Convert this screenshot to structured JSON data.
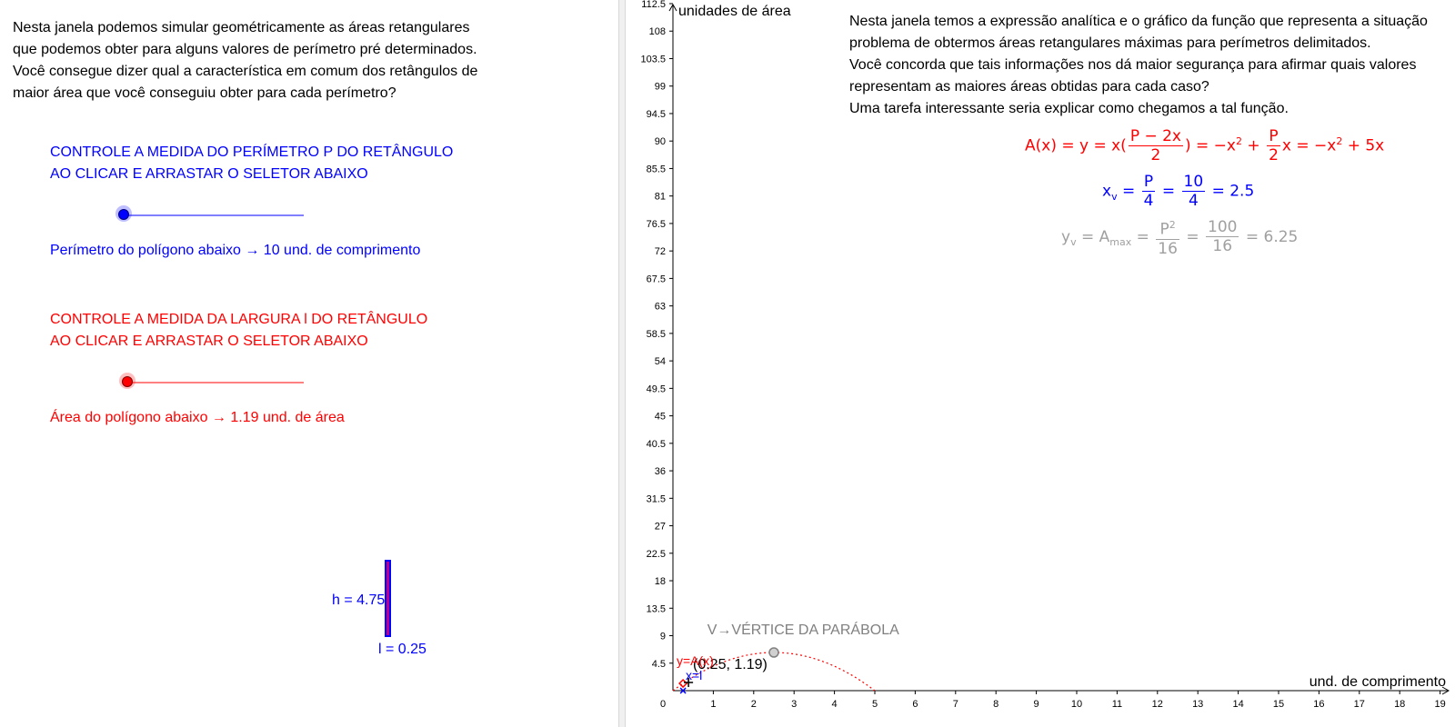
{
  "left": {
    "intro": [
      "Nesta janela podemos simular geométricamente as áreas retangulares",
      "que podemos obter para alguns valores de perímetro pré determinados.",
      "Você consegue dizer qual a característica em comum dos retângulos de",
      "maior área que você conseguiu obter para cada perímetro?"
    ],
    "perimeter_control": {
      "title_lines": [
        "CONTROLE  A MEDIDA DO PERÍMETRO P DO RETÂNGULO",
        "AO CLICAR E ARRASTAR O SELETOR ABAIXO"
      ],
      "readout": "Perímetro do polígono abaixo → 10 und. de comprimento",
      "slider_fraction": 0.0,
      "color": "#0000ff"
    },
    "width_control": {
      "title_lines": [
        "CONTROLE A MEDIDA DA LARGURA l DO RETÂNGULO",
        "AO CLICAR E ARRASTAR O SELETOR ABAIXO"
      ],
      "readout": "Área do polígono abaixo → 1.19 und. de área",
      "slider_fraction": 0.0,
      "color": "#ff0000"
    },
    "rectangle": {
      "h_label": "h = 4.75",
      "l_label": "l = 0.25"
    }
  },
  "right": {
    "text": [
      "Nesta janela temos a expressão analítica e o gráfico da função que representa a situação",
      "problema de obtermos áreas retangulares máximas para perímetros delimitados.",
      "Você concorda que tais informações nos dá maior segurança para afirmar quais valores",
      "representam as maiores áreas obtidas para cada caso?",
      "Uma tarefa interessante seria explicar como chegamos a tal função."
    ],
    "formula_area": {
      "lhs": "A(x) = y = x(",
      "frac_num": "P − 2x",
      "frac_den": "2",
      "mid": ") = −x",
      "mid2": " + ",
      "frac2_num": "P",
      "frac2_den": "2",
      "tail": "x = −x",
      "tail2": " + 5x",
      "sq": "2"
    },
    "formula_xv": {
      "lhs": "x",
      "sub": "v",
      "eq": " = ",
      "f1_num": "P",
      "f1_den": "4",
      "f2_num": "10",
      "f2_den": "4",
      "result": " = 2.5"
    },
    "formula_yv": {
      "lhs": "y",
      "sub": "v",
      "eq1": " = A",
      "sub2": "max",
      "eq": " = ",
      "f1_num": "P",
      "f1_sq": "2",
      "f1_den": "16",
      "f2_num": "100",
      "f2_den": "16",
      "result": " = 6.25"
    },
    "graph": {
      "y_axis_title": "unidades de área",
      "x_axis_title": "und. de comprimento",
      "vertex_label": "V→VÉRTICE DA PARÁBOLA",
      "point_label": "(0.25, 1.19)",
      "curve_label": "y=A(x)",
      "x_point_label": "x=l",
      "origin_label": "0",
      "x_ticks": [
        1,
        2,
        3,
        4,
        5,
        6,
        7,
        8,
        9,
        10,
        11,
        12,
        13,
        14,
        15,
        16,
        17,
        18,
        19
      ],
      "y_ticks": [
        4.5,
        9,
        13.5,
        18,
        22.5,
        27,
        31.5,
        36,
        40.5,
        45,
        49.5,
        54,
        58.5,
        63,
        67.5,
        72,
        76.5,
        81,
        85.5,
        90,
        94.5,
        99,
        103.5,
        108,
        112.5
      ],
      "perimeter": 10,
      "width_l": 0.25,
      "vertex": [
        2.5,
        6.25
      ],
      "point": [
        0.25,
        1.19
      ],
      "curve_color": "#ff0000",
      "vertex_color": "#808080"
    }
  }
}
